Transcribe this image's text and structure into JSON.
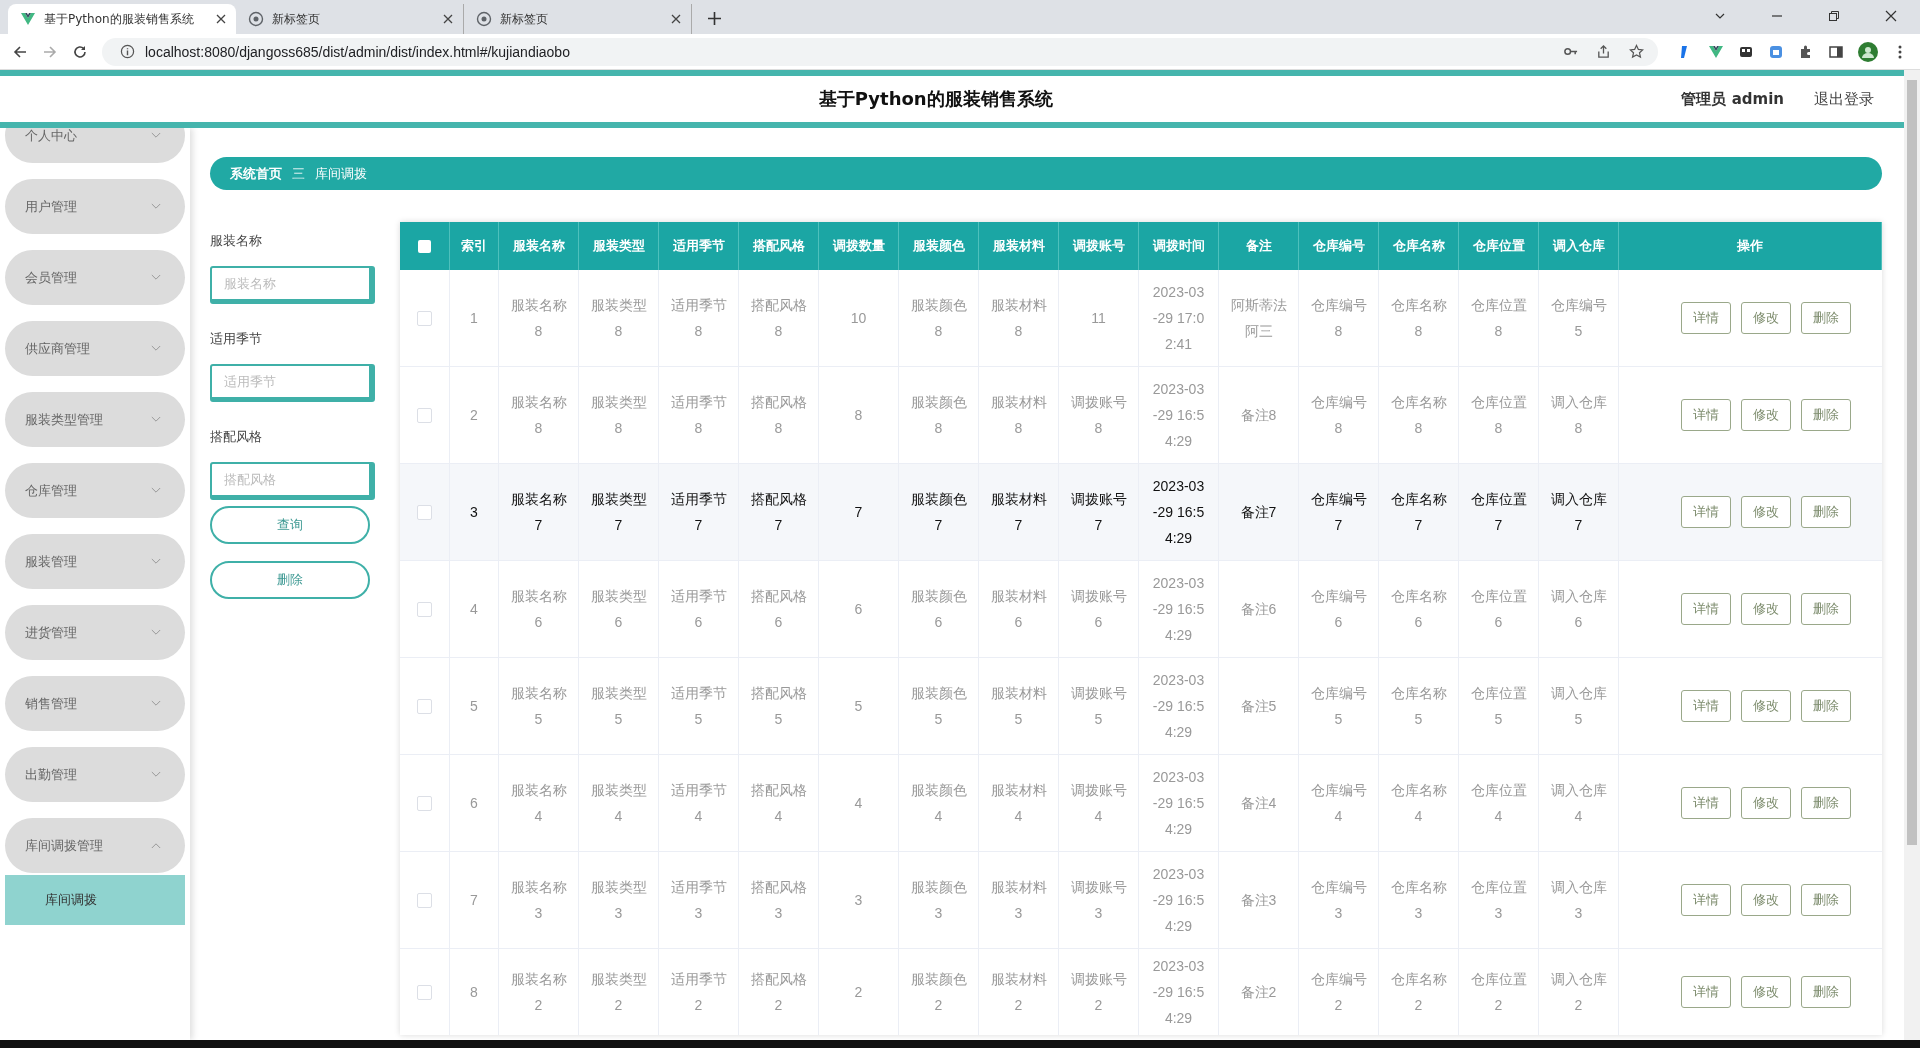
{
  "browser": {
    "tabs": [
      {
        "title": "基于Python的服装销售系统",
        "kind": "app",
        "selected": true
      },
      {
        "title": "新标签页",
        "kind": "blank",
        "selected": false
      },
      {
        "title": "新标签页",
        "kind": "blank",
        "selected": false
      }
    ],
    "url": "localhost:8080/djangoss685/dist/admin/dist/index.html#/kujiandiaobo"
  },
  "header": {
    "title": "基于Python的服装销售系统",
    "user": "管理员 admin",
    "logout": "退出登录"
  },
  "sidebar": {
    "items": [
      {
        "label": "个人中心",
        "expanded": false
      },
      {
        "label": "用户管理",
        "expanded": false
      },
      {
        "label": "会员管理",
        "expanded": false
      },
      {
        "label": "供应商管理",
        "expanded": false
      },
      {
        "label": "服装类型管理",
        "expanded": false
      },
      {
        "label": "仓库管理",
        "expanded": false
      },
      {
        "label": "服装管理",
        "expanded": false
      },
      {
        "label": "进货管理",
        "expanded": false
      },
      {
        "label": "销售管理",
        "expanded": false
      },
      {
        "label": "出勤管理",
        "expanded": false
      },
      {
        "label": "库间调拨管理",
        "expanded": true,
        "children": [
          {
            "label": "库间调拨",
            "selected": true
          }
        ]
      }
    ]
  },
  "breadcrumb": {
    "items": [
      "系统首页",
      "库间调拨"
    ],
    "separator": "三"
  },
  "search": {
    "fields": [
      {
        "label": "服装名称",
        "placeholder": "服装名称"
      },
      {
        "label": "适用季节",
        "placeholder": "适用季节"
      },
      {
        "label": "搭配风格",
        "placeholder": "搭配风格"
      }
    ],
    "buttons": [
      "查询",
      "删除"
    ]
  },
  "table": {
    "header_checked": false,
    "columns": [
      "索引",
      "服装名称",
      "服装类型",
      "适用季节",
      "搭配风格",
      "调拨数量",
      "服装颜色",
      "服装材料",
      "调拨账号",
      "调拨时间",
      "备注",
      "仓库编号",
      "仓库名称",
      "仓库位置",
      "调入仓库",
      "操作"
    ],
    "rows": [
      {
        "checked": false,
        "selected": false,
        "cells": [
          "1",
          "服装名称8",
          "服装类型8",
          "适用季节8",
          "搭配风格8",
          "10",
          "服装颜色8",
          "服装材料8",
          "11",
          "2023-03-29 17:02:41",
          "阿斯蒂法阿三",
          "仓库编号8",
          "仓库名称8",
          "仓库位置8",
          "仓库编号5"
        ],
        "actions": [
          "详情",
          "修改",
          "删除"
        ]
      },
      {
        "checked": false,
        "selected": false,
        "cells": [
          "2",
          "服装名称8",
          "服装类型8",
          "适用季节8",
          "搭配风格8",
          "8",
          "服装颜色8",
          "服装材料8",
          "调拨账号8",
          "2023-03-29 16:54:29",
          "备注8",
          "仓库编号8",
          "仓库名称8",
          "仓库位置8",
          "调入仓库8"
        ],
        "actions": [
          "详情",
          "修改",
          "删除"
        ]
      },
      {
        "checked": false,
        "selected": true,
        "cells": [
          "3",
          "服装名称7",
          "服装类型7",
          "适用季节7",
          "搭配风格7",
          "7",
          "服装颜色7",
          "服装材料7",
          "调拨账号7",
          "2023-03-29 16:54:29",
          "备注7",
          "仓库编号7",
          "仓库名称7",
          "仓库位置7",
          "调入仓库7"
        ],
        "actions": [
          "详情",
          "修改",
          "删除"
        ]
      },
      {
        "checked": false,
        "selected": false,
        "cells": [
          "4",
          "服装名称6",
          "服装类型6",
          "适用季节6",
          "搭配风格6",
          "6",
          "服装颜色6",
          "服装材料6",
          "调拨账号6",
          "2023-03-29 16:54:29",
          "备注6",
          "仓库编号6",
          "仓库名称6",
          "仓库位置6",
          "调入仓库6"
        ],
        "actions": [
          "详情",
          "修改",
          "删除"
        ]
      },
      {
        "checked": false,
        "selected": false,
        "cells": [
          "5",
          "服装名称5",
          "服装类型5",
          "适用季节5",
          "搭配风格5",
          "5",
          "服装颜色5",
          "服装材料5",
          "调拨账号5",
          "2023-03-29 16:54:29",
          "备注5",
          "仓库编号5",
          "仓库名称5",
          "仓库位置5",
          "调入仓库5"
        ],
        "actions": [
          "详情",
          "修改",
          "删除"
        ]
      },
      {
        "checked": false,
        "selected": false,
        "cells": [
          "6",
          "服装名称4",
          "服装类型4",
          "适用季节4",
          "搭配风格4",
          "4",
          "服装颜色4",
          "服装材料4",
          "调拨账号4",
          "2023-03-29 16:54:29",
          "备注4",
          "仓库编号4",
          "仓库名称4",
          "仓库位置4",
          "调入仓库4"
        ],
        "actions": [
          "详情",
          "修改",
          "删除"
        ]
      },
      {
        "checked": false,
        "selected": false,
        "cells": [
          "7",
          "服装名称3",
          "服装类型3",
          "适用季节3",
          "搭配风格3",
          "3",
          "服装颜色3",
          "服装材料3",
          "调拨账号3",
          "2023-03-29 16:54:29",
          "备注3",
          "仓库编号3",
          "仓库名称3",
          "仓库位置3",
          "调入仓库3"
        ],
        "actions": [
          "详情",
          "修改",
          "删除"
        ]
      },
      {
        "checked": false,
        "selected": false,
        "cells": [
          "8",
          "服装名称2",
          "服装类型2",
          "适用季节2",
          "搭配风格2",
          "2",
          "服装颜色2",
          "服装材料2",
          "调拨账号2",
          "2023-03-29 16:54:29",
          "备注2",
          "仓库编号2",
          "仓库名称2",
          "仓库位置2",
          "调入仓库2"
        ],
        "actions": [
          "详情",
          "修改",
          "删除"
        ]
      }
    ]
  }
}
